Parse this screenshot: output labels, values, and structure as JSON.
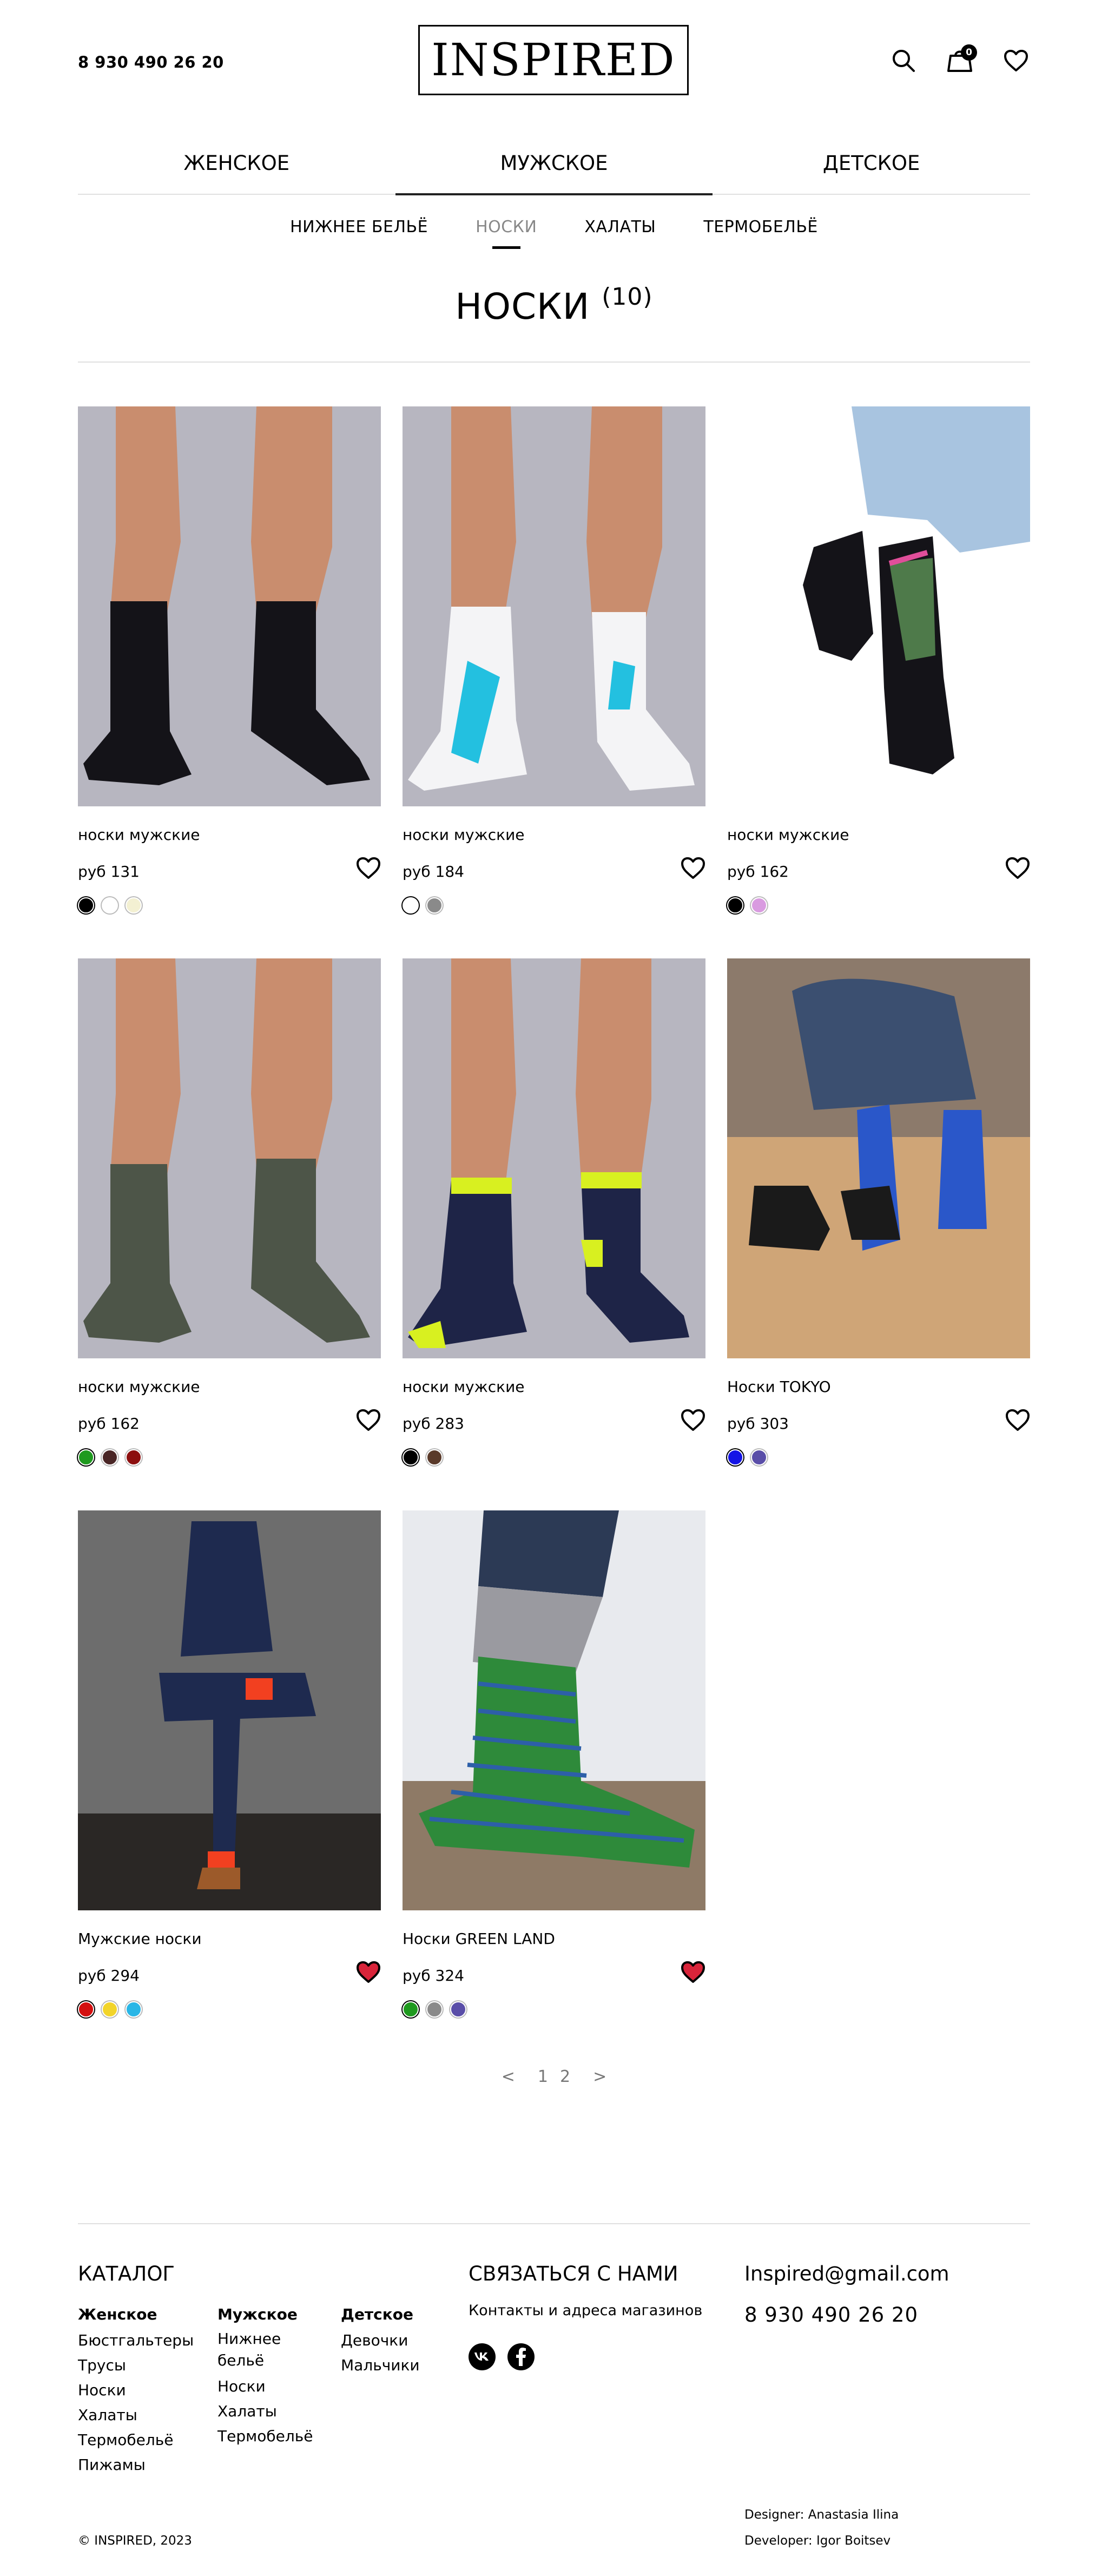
{
  "header": {
    "phone": "8 930 490 26 20",
    "logo": "INSPIRED",
    "cart_count": "0"
  },
  "gender_tabs": [
    {
      "label": "ЖЕНСКОЕ"
    },
    {
      "label": "МУЖСКОЕ",
      "active": true
    },
    {
      "label": "ДЕТСКОЕ"
    }
  ],
  "sub_tabs": [
    {
      "label": "НИЖНЕЕ БЕЛЬЁ"
    },
    {
      "label": "НОСКИ",
      "active": true
    },
    {
      "label": "ХАЛАТЫ"
    },
    {
      "label": "ТЕРМОБЕЛЬЁ"
    }
  ],
  "page": {
    "title": "НОСКИ",
    "count": "(10)"
  },
  "products": [
    {
      "name": "носки мужские",
      "price": "руб 131",
      "favorite": false,
      "colors": [
        "#000000",
        "#ffffff",
        "#f3f0d2"
      ],
      "image": "black-socks-photo"
    },
    {
      "name": "носки мужские",
      "price": "руб 184",
      "favorite": false,
      "colors": [
        "#ffffff",
        "#8a8a8a"
      ],
      "image": "white-socks-photo"
    },
    {
      "name": "носки мужские",
      "price": "руб 162",
      "favorite": false,
      "colors": [
        "#000000",
        "#d99be0"
      ],
      "image": "black-tokyo-socks-photo"
    },
    {
      "name": "носки мужские",
      "price": "руб 162",
      "favorite": false,
      "colors": [
        "#1f9a1f",
        "#4a2626",
        "#8c0f0f"
      ],
      "image": "olive-socks-photo"
    },
    {
      "name": "носки мужские",
      "price": "руб 283",
      "favorite": false,
      "colors": [
        "#000000",
        "#5a3a2a"
      ],
      "image": "navy-dotted-socks-photo"
    },
    {
      "name": "Носки TOKYO",
      "price": "руб 303",
      "favorite": false,
      "colors": [
        "#1414e6",
        "#5a4ea8"
      ],
      "image": "tokyo-socks-photo"
    },
    {
      "name": "Мужские носки",
      "price": "руб 294",
      "favorite": true,
      "colors": [
        "#d40f0f",
        "#f2d42a",
        "#29b6e6"
      ],
      "image": "red-socks-suit-photo"
    },
    {
      "name": "Носки GREEN LAND",
      "price": "руб 324",
      "favorite": true,
      "colors": [
        "#1f9a1f",
        "#8a8a8a",
        "#5a4ea8"
      ],
      "image": "striped-socks-photo"
    }
  ],
  "pagination": {
    "prev": "<",
    "pages": [
      "1",
      "2"
    ],
    "next": ">"
  },
  "footer": {
    "catalog_title": "КАТАЛОГ",
    "women_title": "Женское",
    "women_items": [
      "Бюстгальтеры",
      "Трусы",
      "Носки",
      "Халаты",
      "Термобельё",
      "Пижамы"
    ],
    "men_title": "Мужское",
    "men_items": [
      "Нижнее бельё",
      "Носки",
      "Халаты",
      "Термобельё"
    ],
    "kids_title": "Детское",
    "kids_items": [
      "Девочки",
      "Мальчики"
    ],
    "contact_title": "СВЯЗАТЬСЯ С НАМИ",
    "contact_link": "Контакты и адреса магазинов",
    "email": "Inspired@gmail.com",
    "phone": "8 930 490 26 20",
    "copyright": "© INSPIRED, 2023",
    "designer": "Designer: Anastasia Ilina",
    "developer": "Developer: Igor Boitsev"
  },
  "colors": {
    "heart_filled": "#d9243a",
    "accent": "#000000"
  }
}
